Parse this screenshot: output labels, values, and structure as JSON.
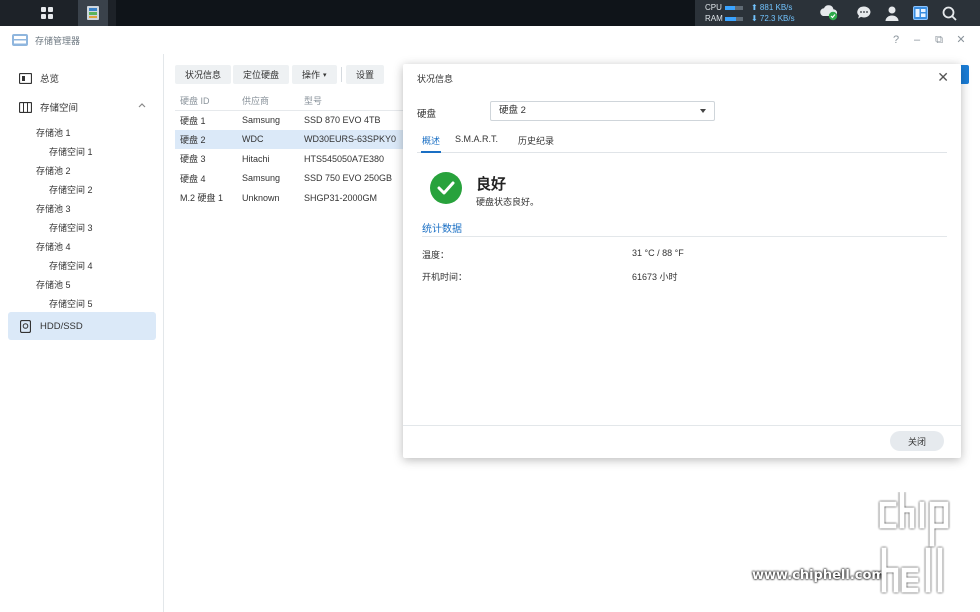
{
  "taskbar": {
    "cpu_label": "CPU",
    "ram_label": "RAM",
    "cpu_upload": "⬆ 881 KB/s",
    "ram_download": "⬇ 72.3 KB/s",
    "cpu_usage_fraction": 0.55,
    "ram_usage_fraction": 0.6
  },
  "app": {
    "title": "存储管理器"
  },
  "sidebar": {
    "overview": "总览",
    "storage": "存储空间",
    "pools": [
      {
        "pool": "存储池 1",
        "volume": "存储空间 1"
      },
      {
        "pool": "存储池 2",
        "volume": "存储空间 2"
      },
      {
        "pool": "存储池 3",
        "volume": "存储空间 3"
      },
      {
        "pool": "存储池 4",
        "volume": "存储空间 4"
      },
      {
        "pool": "存储池 5",
        "volume": "存储空间 5"
      }
    ],
    "hdd": "HDD/SSD"
  },
  "toolbar": {
    "status_info": "状况信息",
    "locate_disk": "定位硬盘",
    "actions": "操作",
    "settings": "设置"
  },
  "disk_table": {
    "headers": [
      "硬盘 ID",
      "供应商",
      "型号"
    ],
    "rows": [
      [
        "硬盘 1",
        "Samsung",
        "SSD 870 EVO 4TB"
      ],
      [
        "硬盘 2",
        "WDC",
        "WD30EURS-63SPKY0"
      ],
      [
        "硬盘 3",
        "Hitachi",
        "HTS545050A7E380"
      ],
      [
        "硬盘 4",
        "Samsung",
        "SSD 750 EVO 250GB"
      ],
      [
        "M.2 硬盘 1",
        "Unknown",
        "SHGP31-2000GM"
      ]
    ],
    "selected_index": 1
  },
  "dialog": {
    "title": "状况信息",
    "disk_label": "硬盘",
    "disk_selected": "硬盘 2",
    "tabs": [
      "概述",
      "S.M.A.R.T.",
      "历史纪录"
    ],
    "status_title": "良好",
    "status_desc": "硬盘状态良好。",
    "section_title": "统计数据",
    "temp_label": "温度：",
    "temp_value": "31 °C / 88 °F",
    "uptime_label": "开机时间：",
    "uptime_value": "61673 小时",
    "close_button": "关闭"
  },
  "watermark": {
    "url": "www.chiphell.com"
  },
  "colors": {
    "accent": "#1a6fc4",
    "good": "#28a23c",
    "selection": "#dbe9f8"
  }
}
